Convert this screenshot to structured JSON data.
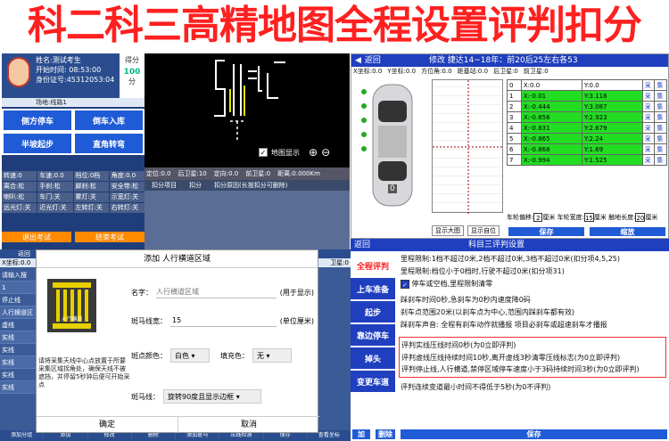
{
  "banner": "科二科三高精地图全程设置评判扣分",
  "exam": {
    "name": "姓名:测试考生",
    "start": "开始时间: 08:53:00",
    "id": "身份证号:45312053:04",
    "score_label": "得分",
    "score": "100",
    "score_unit": "分",
    "venue": "场地:线路1",
    "buttons": [
      "侧方停车",
      "倒车入库",
      "半坡起步",
      "直角转弯"
    ],
    "stats": [
      [
        "转速:0",
        "车速:0.0",
        "档位:0档",
        "角度:0.0"
      ],
      [
        "离合:松",
        "手刹:松",
        "脚刹:松",
        "安全带:松"
      ],
      [
        "喇叭:松",
        "车门:关",
        "雾灯:关",
        "示宽灯:关"
      ],
      [
        "远光灯:关",
        "近光灯:关",
        "左转灯:关",
        "右转灯:关"
      ]
    ],
    "exit": "退出考试",
    "end": "结束考试"
  },
  "map": {
    "toggle": "地图显示",
    "stats": [
      "定位:0.0",
      "后卫星:10",
      "定向:0.0",
      "前卫星:0",
      "距离:0.000Km"
    ],
    "headers": [
      "扣分项目",
      "扣分",
      "扣分原因(长按扣分可删除)"
    ]
  },
  "edit": {
    "back": "返回",
    "title": "修改  捷达14~18年：前20后25左右各53",
    "coords": [
      "X坐标:0.0",
      "Y坐标:0.0",
      "方位角:0.0",
      "距基站:0.0",
      "后卫星:0",
      "前卫星:0"
    ],
    "rows": [
      [
        "0",
        "X:0.0",
        "Y:0.0"
      ],
      [
        "1",
        "X:-0.01",
        "Y:3.118"
      ],
      [
        "2",
        "X:-0.444",
        "Y:3.087"
      ],
      [
        "3",
        "X:-0.656",
        "Y:2.923"
      ],
      [
        "4",
        "X:-0.831",
        "Y:2.679"
      ],
      [
        "5",
        "X:-0.865",
        "Y:2.24"
      ],
      [
        "6",
        "X:-0.868",
        "Y:1.69"
      ],
      [
        "7",
        "X:-0.994",
        "Y:1.525"
      ]
    ],
    "cols": [
      "采",
      "集"
    ],
    "car_no": "0",
    "bottom": [
      "车轮偏移:",
      "2",
      "厘米",
      "车轮宽度:",
      "15",
      "厘米",
      "触地长度:",
      "20",
      "厘米"
    ],
    "btns": [
      "显示大图",
      "显示自位",
      "保存",
      "缩放"
    ]
  },
  "settings": {
    "back": "返回",
    "title": "科目三评判设置",
    "menu": [
      "全程评判",
      "上车准备",
      "起步",
      "靠边停车",
      "掉头",
      "变更车道"
    ],
    "lines": [
      "里程限制:1档不超过0米,2档不超过0米,3档不超过0米(扣分项4,5,25)",
      "里程限制:档位小于0档时,行驶不超过0米(扣分项31)",
      "停车或空档,里程限制清零",
      "踩刹车时间0秒,急刹车为0秒内速度降0码",
      "刹车点范围20米(以刹车点为中心,范围内踩刹车都有效)",
      "踩刹车声音:  全程有刹车动作就播报  项目必刹车或超速刹车才播报",
      "评判实线压线时间0秒(为0立即评判)",
      "评判虚线压线持续时间10秒,离开虚线3秒清零压线标志(为0立即评判)",
      "评判停止线,人行横道,禁停区域停车速度小于3码持续时间3秒(为0立即评判)",
      "评判连续变道最小时间不得低于5秒(为0不评判)"
    ],
    "bottom": [
      "加",
      "删除",
      "保存"
    ]
  },
  "dialog": {
    "title": "添加 人行横道区域",
    "crosswalk_label": "人行横道",
    "name_label": "名字：",
    "name_placeholder": "人行横道区域",
    "name_suffix": "(用于显示)",
    "width_label": "斑马线宽：",
    "width_value": "15",
    "width_suffix": "(单位厘米)",
    "color_label": "斑点颜色：",
    "color_value": "白色",
    "fill_label": "填充色：",
    "fill_value": "无",
    "stripe_label": "斑马线：",
    "stripe_value": "旋转90度且显示边框",
    "hint": "请将采集天线中心点放置于所要采集区域拐角处，确保天线不被遮挡，并停留5秒钟后便可开始采点",
    "ok": "确定",
    "cancel": "取消"
  },
  "behind": {
    "back": "返回",
    "side": [
      "请输入搜",
      "1",
      "停止线",
      "人行横道区",
      "虚线",
      "实线",
      "实线",
      "实线",
      "实线",
      "实线"
    ],
    "sat": "卫星:0",
    "xcoord": "X坐标:0.0",
    "bottom": [
      "添加分组",
      "添加",
      "修改",
      "删除",
      "添加斑马",
      "压线检测",
      "保存",
      "查看坐标"
    ]
  },
  "colors": {
    "green": "#22dd22",
    "blue": "#1f3fbf",
    "red": "#ff2020"
  }
}
